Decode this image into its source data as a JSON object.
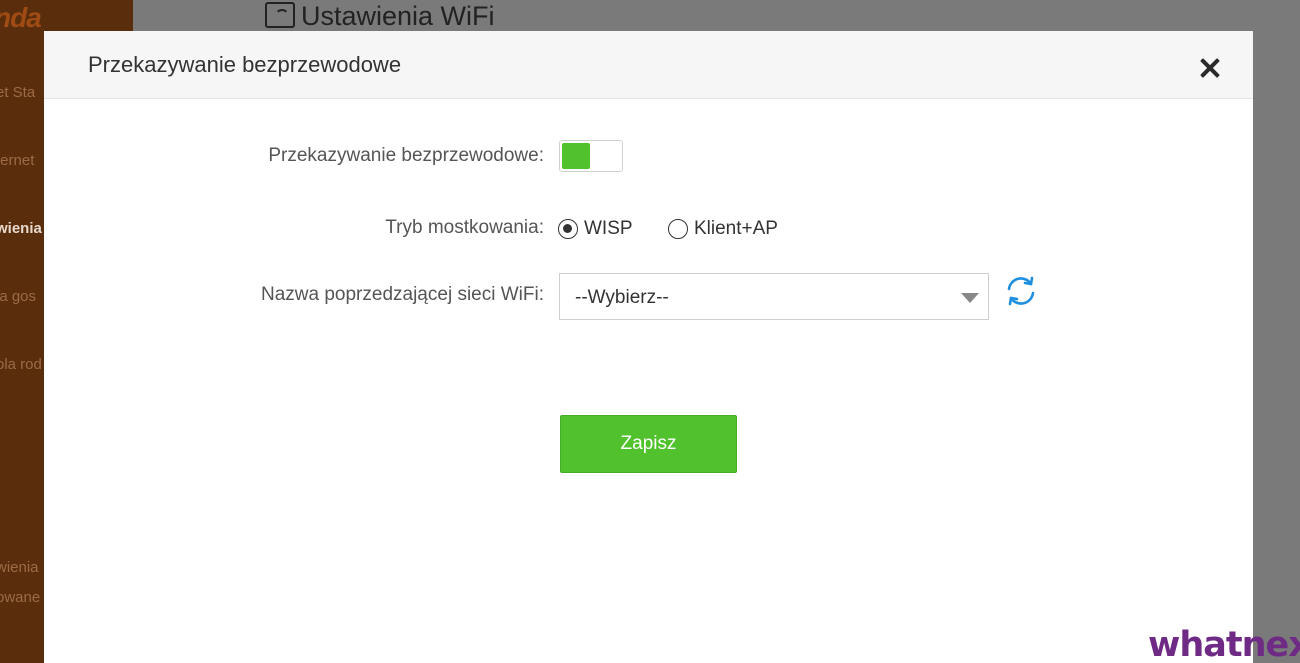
{
  "background": {
    "logo": "nda",
    "page_title": "Ustawienia WiFi",
    "nav_items": [
      {
        "label": "et Sta",
        "active": false
      },
      {
        "label": "ternet",
        "active": false
      },
      {
        "label": "wienia",
        "active": true
      },
      {
        "label": "la gos",
        "active": false
      },
      {
        "label": "ola rod",
        "active": false
      },
      {
        "label": "wienia",
        "active": false
      },
      {
        "label": "owane",
        "active": false
      }
    ]
  },
  "modal": {
    "title": "Przekazywanie bezprzewodowe",
    "toggle_label": "Przekazywanie bezprzewodowe:",
    "toggle_on": true,
    "mode_label": "Tryb mostkowania:",
    "mode_options": [
      {
        "label": "WISP",
        "checked": true
      },
      {
        "label": "Klient+AP",
        "checked": false
      }
    ],
    "ssid_label": "Nazwa poprzedzającej sieci WiFi:",
    "ssid_value": "--Wybierz--",
    "save_label": "Zapisz"
  },
  "colors": {
    "accent_green": "#51c22d",
    "refresh_blue": "#1e8fe0",
    "sidebar_brown": "#5a2e0c"
  },
  "watermark": "whatnext"
}
